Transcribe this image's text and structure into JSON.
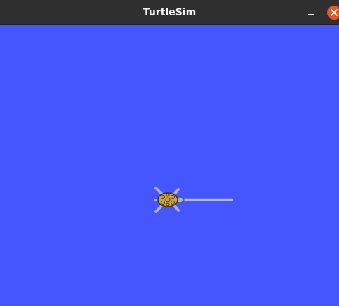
{
  "window": {
    "title": "TurtleSim"
  },
  "canvas": {
    "background_color": "#4556ff",
    "pen_color": "#b3b8ff"
  },
  "turtle": {
    "icon": "turtle-icon",
    "shell_color": "#c9a54a"
  }
}
